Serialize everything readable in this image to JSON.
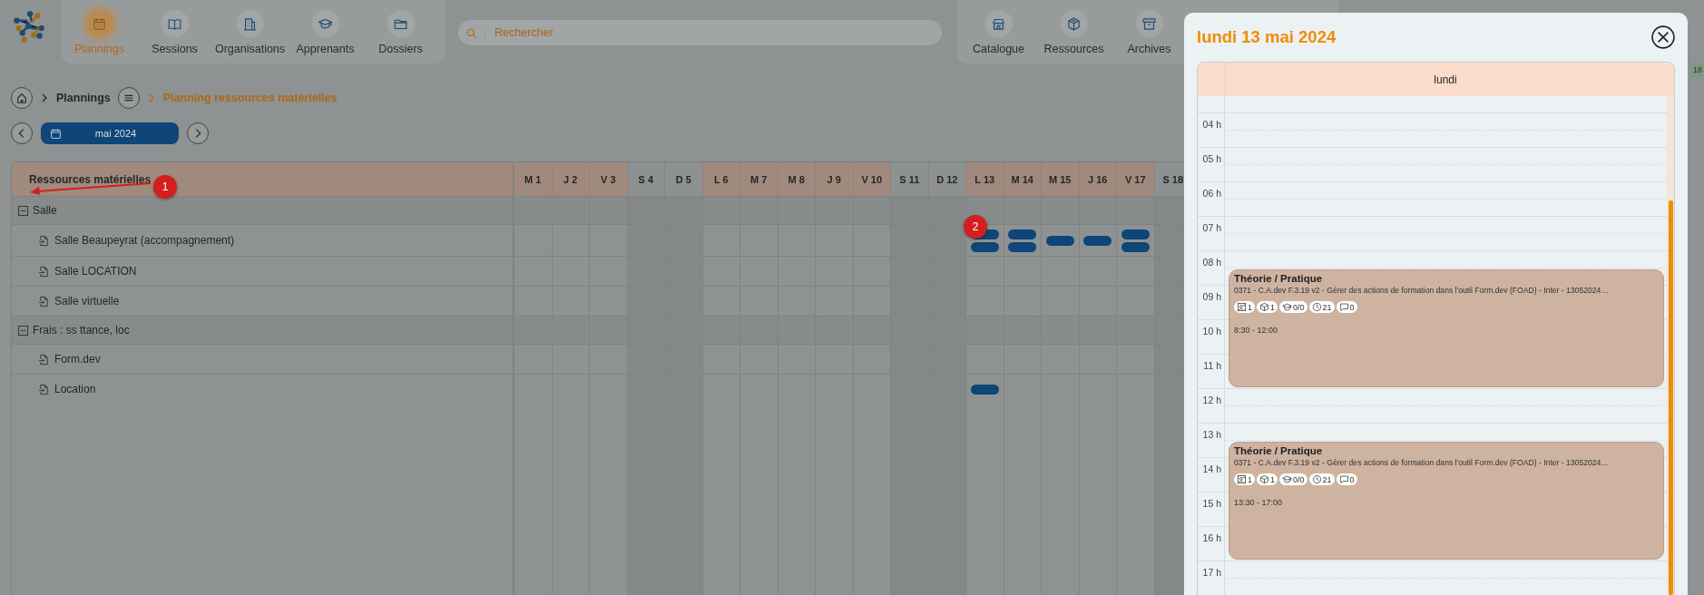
{
  "nav_left": [
    {
      "label": "Plannings",
      "selected": true
    },
    {
      "label": "Sessions",
      "selected": false
    },
    {
      "label": "Organisations",
      "selected": false
    },
    {
      "label": "Apprenants",
      "selected": false
    },
    {
      "label": "Dossiers",
      "selected": false
    }
  ],
  "search": {
    "placeholder": "Rechercher"
  },
  "nav_right": [
    {
      "label": "Catalogue",
      "selected": false
    },
    {
      "label": "Ressources",
      "selected": false
    },
    {
      "label": "Archives",
      "selected": false
    }
  ],
  "edge_label": "18",
  "breadcrumb": {
    "parent": "Plannings",
    "current": "Planning ressources matérielles"
  },
  "month": {
    "label": "mai 2024"
  },
  "table": {
    "heading": "Ressources matérielles",
    "days": [
      {
        "label": "M 1",
        "weekend": false
      },
      {
        "label": "J 2",
        "weekend": false
      },
      {
        "label": "V 3",
        "weekend": false
      },
      {
        "label": "S 4",
        "weekend": true
      },
      {
        "label": "D 5",
        "weekend": true
      },
      {
        "label": "L 6",
        "weekend": false
      },
      {
        "label": "M 7",
        "weekend": false
      },
      {
        "label": "M 8",
        "weekend": false
      },
      {
        "label": "J 9",
        "weekend": false
      },
      {
        "label": "V 10",
        "weekend": false
      },
      {
        "label": "S 11",
        "weekend": true
      },
      {
        "label": "D 12",
        "weekend": true
      },
      {
        "label": "L 13",
        "weekend": false
      },
      {
        "label": "M 14",
        "weekend": false
      },
      {
        "label": "M 15",
        "weekend": false
      },
      {
        "label": "J 16",
        "weekend": false
      },
      {
        "label": "V 17",
        "weekend": false
      },
      {
        "label": "S 18",
        "weekend": true
      }
    ],
    "groups": [
      {
        "name": "Salle",
        "expanded": true,
        "children": [
          {
            "name": "Salle Beaupeyrat (accompagnement)",
            "cells": [
              {},
              {},
              {},
              {},
              {},
              {},
              {},
              {},
              {},
              {},
              {},
              {},
              {
                "bookings": [
                  {
                    "kind": "session"
                  },
                  {
                    "kind": "session"
                  }
                ]
              },
              {
                "bookings": [
                  {
                    "kind": "session"
                  },
                  {
                    "kind": "session"
                  }
                ]
              },
              {
                "bookings": [
                  {
                    "kind": "session"
                  }
                ]
              },
              {
                "bookings": [
                  {
                    "kind": "session"
                  }
                ]
              },
              {
                "bookings": [
                  {
                    "kind": "session"
                  },
                  {
                    "kind": "session"
                  }
                ]
              },
              {}
            ]
          },
          {
            "name": "Salle LOCATION"
          },
          {
            "name": "Salle virtuelle"
          }
        ]
      },
      {
        "name": "Frais : ss ttance, loc",
        "expanded": true,
        "children": [
          {
            "name": "Form.dev"
          },
          {
            "name": "Location",
            "cells": [
              {},
              {},
              {},
              {},
              {},
              {},
              {},
              {},
              {},
              {},
              {},
              {},
              {
                "bookings": [
                  {
                    "kind": "session"
                  }
                ]
              },
              {},
              {},
              {},
              {},
              {}
            ]
          }
        ]
      }
    ]
  },
  "annotations": [
    {
      "label": "1",
      "kind": "arrow"
    },
    {
      "label": "2",
      "kind": "marker"
    }
  ],
  "modal": {
    "title": "lundi 13 mai 2024",
    "column": "lundi",
    "hours": [
      "04 h",
      "05 h",
      "06 h",
      "07 h",
      "08 h",
      "09 h",
      "10 h",
      "11 h",
      "12 h",
      "13 h",
      "14 h",
      "15 h",
      "16 h",
      "17 h"
    ],
    "events": [
      {
        "title": "Théorie / Pratique",
        "subtitle": "0371 - C.A.dev F.3.19 v2 - Gérer des actions de formation dans l'outil Form.dev (FOAD) - Inter - 13052024…",
        "badges": [
          {
            "kind": "rooms",
            "count": "1"
          },
          {
            "kind": "resources",
            "count": "1"
          },
          {
            "kind": "learners",
            "count": "0/0"
          },
          {
            "kind": "hours",
            "count": "21"
          },
          {
            "kind": "comments",
            "count": "0"
          }
        ],
        "time": "8:30 - 12:00"
      },
      {
        "title": "Théorie / Pratique",
        "subtitle": "0371 - C.A.dev F.3.19 v2 - Gérer des actions de formation dans l'outil Form.dev (FOAD) - Inter - 13052024…",
        "badges": [
          {
            "kind": "rooms",
            "count": "1"
          },
          {
            "kind": "resources",
            "count": "1"
          },
          {
            "kind": "learners",
            "count": "0/0"
          },
          {
            "kind": "hours",
            "count": "21"
          },
          {
            "kind": "comments",
            "count": "0"
          }
        ],
        "time": "13:30 - 17:00"
      }
    ]
  }
}
